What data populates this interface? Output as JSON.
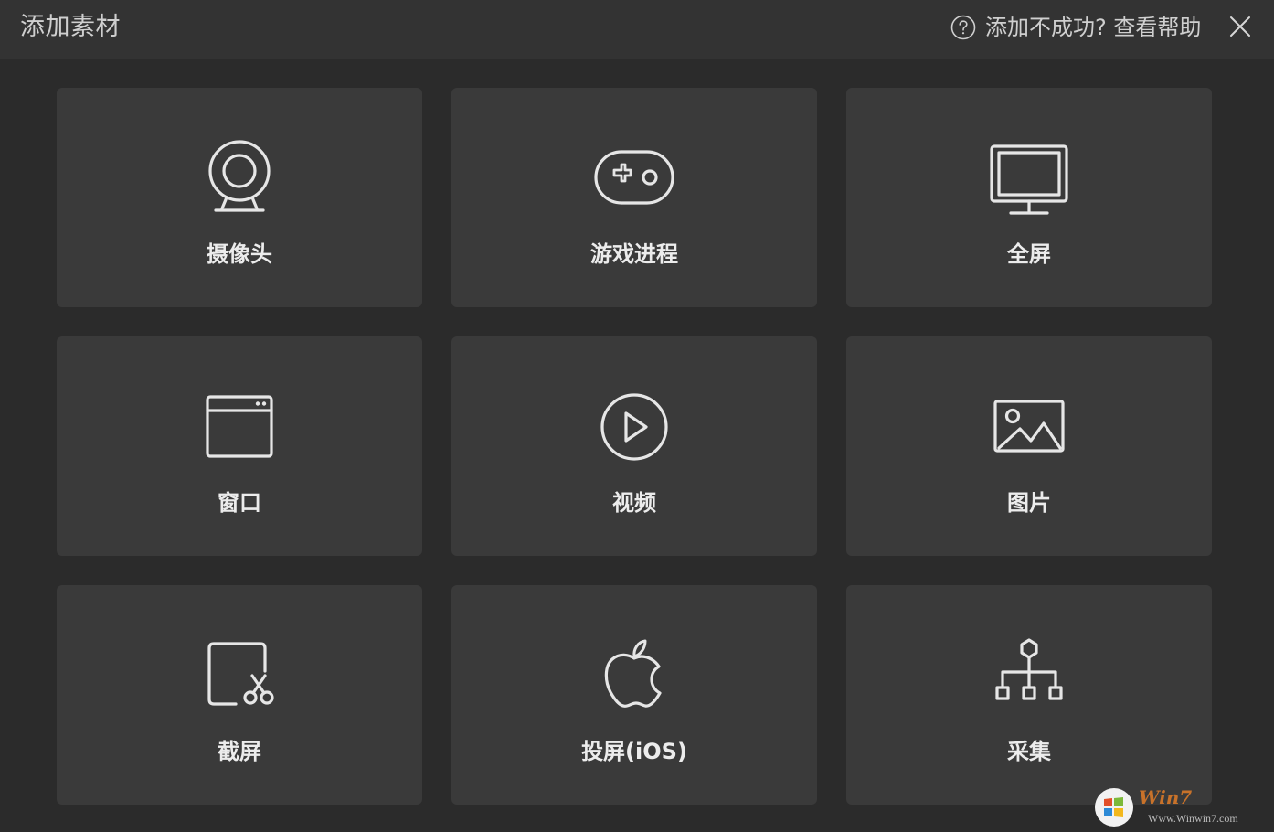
{
  "window": {
    "title": "添加素材",
    "help_text": "添加不成功? 查看帮助",
    "close_icon": "close-icon",
    "help_icon": "question-circle-icon"
  },
  "tiles": [
    {
      "label": "摄像头",
      "icon": "webcam-icon"
    },
    {
      "label": "游戏进程",
      "icon": "gamepad-icon"
    },
    {
      "label": "全屏",
      "icon": "monitor-icon"
    },
    {
      "label": "窗口",
      "icon": "window-icon"
    },
    {
      "label": "视频",
      "icon": "play-circle-icon"
    },
    {
      "label": "图片",
      "icon": "image-icon"
    },
    {
      "label": "截屏",
      "icon": "screenshot-scissors-icon"
    },
    {
      "label": "投屏(iOS)",
      "icon": "apple-icon"
    },
    {
      "label": "采集",
      "icon": "network-hierarchy-icon"
    }
  ],
  "watermark": {
    "brand": "Win7",
    "url": "Www.Winwin7.com"
  },
  "colors": {
    "background": "#2b2b2b",
    "titlebar": "#333333",
    "tile": "#3a3a3a",
    "icon_stroke": "#e6e6e6",
    "label": "#ececec",
    "muted_text": "#cfcfcf"
  }
}
